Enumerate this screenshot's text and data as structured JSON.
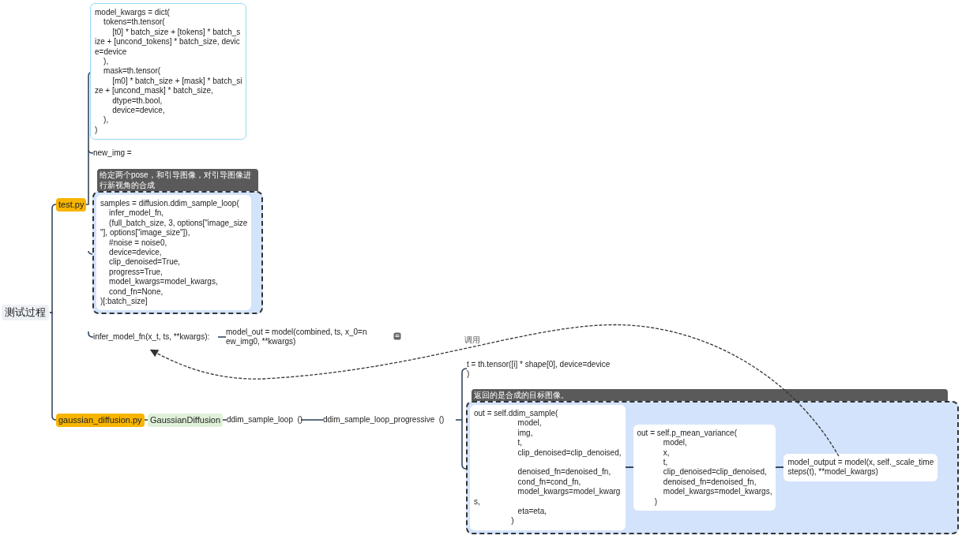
{
  "root": {
    "label": "测试过程",
    "children": [
      {
        "kind": "file",
        "label": "test.py",
        "children": [
          {
            "kind": "code",
            "text": "model_kwargs = dict(\n    tokens=th.tensor(\n        [t0] * batch_size + [tokens] * batch_s\nize + [uncond_tokens] * batch_size, devic\ne=device\n    ),\n    mask=th.tensor(\n        [m0] * batch_size + [mask] * batch_si\nze + [uncond_mask] * batch_size,\n        dtype=th.bool,\n        device=device,\n    ),\n)"
          },
          {
            "kind": "text",
            "text": "new_img ="
          },
          {
            "kind": "group",
            "note": "给定两个pose，和引导图像，对引导图像进行新视角的合成",
            "children": [
              {
                "kind": "code",
                "text": "samples = diffusion.ddim_sample_loop(\n    infer_model_fn,\n    (full_batch_size, 3, options[\"image_size\n\"], options[\"image_size\"]),\n    #noise = noise0,\n    device=device,\n    clip_denoised=True,\n    progress=True,\n    model_kwargs=model_kwargs,\n    cond_fn=None,\n)[:batch_size]"
              }
            ]
          },
          {
            "kind": "text",
            "text": "infer_model_fn(x_t, ts, **kwargs):",
            "children": [
              {
                "kind": "text",
                "text": "model_out = model(combined, ts, x_0=n\new_img0, **kwargs)",
                "has_notes": true
              }
            ]
          }
        ]
      },
      {
        "kind": "file",
        "label": "gaussian_diffusion.py",
        "children": [
          {
            "kind": "class",
            "label": "GaussianDiffusion",
            "children": [
              {
                "kind": "text",
                "text": "ddim_sample_loop  ()",
                "children": [
                  {
                    "kind": "text",
                    "text": "ddim_sample_loop_progressive  ()",
                    "children": [
                      {
                        "kind": "text",
                        "text": "t = th.tensor([i] * shape[0], device=device\n)"
                      },
                      {
                        "kind": "group",
                        "note": "返回的是合成的目标图像。",
                        "children": [
                          {
                            "kind": "code",
                            "text": "out = self.ddim_sample(\n                    model,\n                    img,\n                    t,\n                    clip_denoised=clip_denoised,\n\n                    denoised_fn=denoised_fn,\n                    cond_fn=cond_fn,\n                    model_kwargs=model_kwarg\ns,\n                    eta=eta,\n                 )",
                            "children": [
                              {
                                "kind": "code",
                                "text": "out = self.p_mean_variance(\n            model,\n            x,\n            t,\n            clip_denoised=clip_denoised,\n            denoised_fn=denoised_fn,\n            model_kwargs=model_kwargs,\n        )",
                                "children": [
                                  {
                                    "kind": "code",
                                    "text": "model_output = model(x, self._scale_time\nsteps(t), **model_kwargs)"
                                  }
                                ]
                              }
                            ]
                          }
                        ]
                      }
                    ]
                  }
                ]
              }
            ]
          }
        ]
      }
    ]
  },
  "relationship": {
    "label": "调用"
  }
}
